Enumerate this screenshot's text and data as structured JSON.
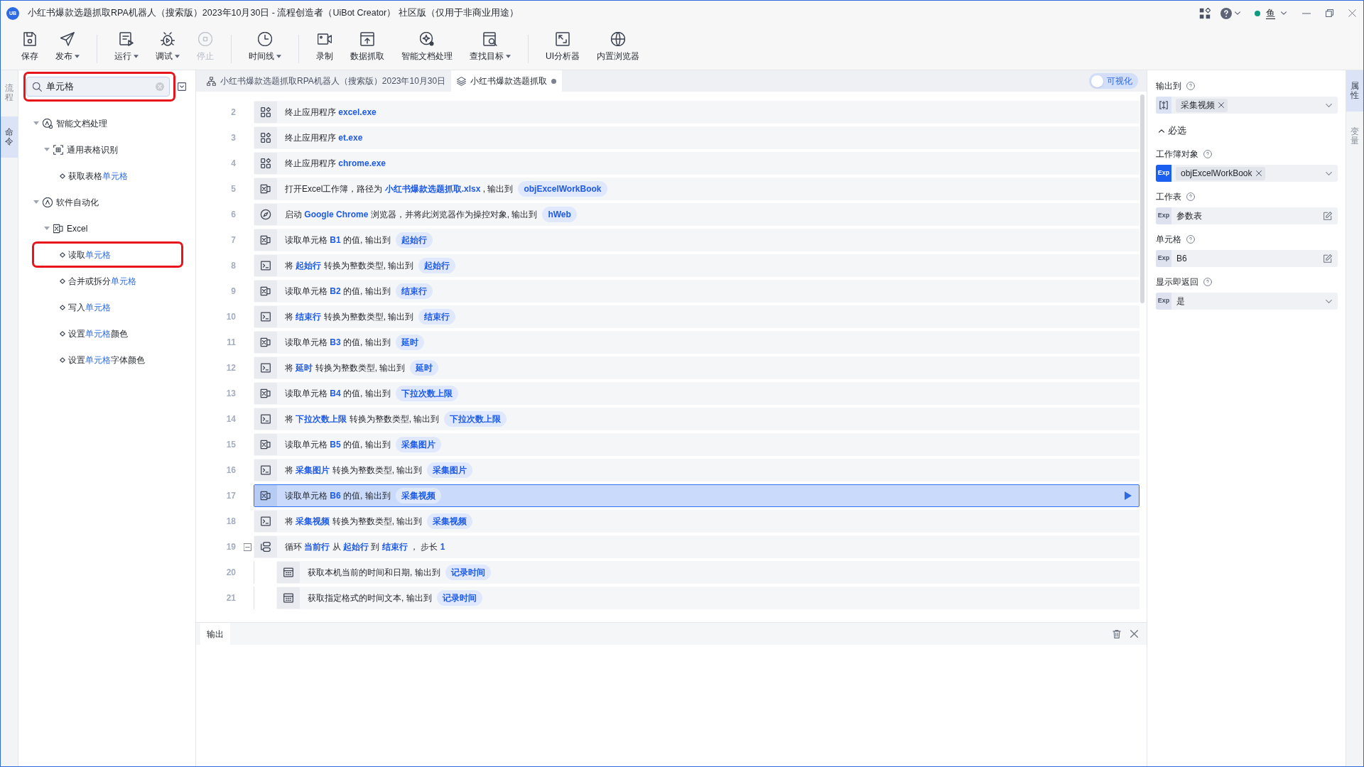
{
  "window": {
    "logo": "UB",
    "title": "小红书爆款选题抓取RPA机器人（搜索版）2023年10月30日 - 流程创造者（UiBot Creator） 社区版（仅用于非商业用途）",
    "user": "鱼"
  },
  "toolbar": {
    "groups": [
      {
        "items": [
          {
            "kind": "save",
            "label": "保存",
            "dropdown": false,
            "disabled": false
          },
          {
            "kind": "publish",
            "label": "发布",
            "dropdown": true,
            "disabled": false
          }
        ]
      },
      {
        "items": [
          {
            "kind": "run",
            "label": "运行",
            "dropdown": true,
            "disabled": false
          },
          {
            "kind": "debug",
            "label": "调试",
            "dropdown": true,
            "disabled": false
          },
          {
            "kind": "stop",
            "label": "停止",
            "dropdown": false,
            "disabled": true
          }
        ]
      },
      {
        "items": [
          {
            "kind": "timeline",
            "label": "时间线",
            "dropdown": true,
            "disabled": false
          }
        ]
      },
      {
        "items": [
          {
            "kind": "record",
            "label": "录制",
            "dropdown": false,
            "disabled": false
          },
          {
            "kind": "scrape",
            "label": "数据抓取",
            "dropdown": false,
            "disabled": false
          },
          {
            "kind": "document",
            "label": "智能文档处理",
            "dropdown": false,
            "disabled": false
          },
          {
            "kind": "find",
            "label": "查找目标",
            "dropdown": true,
            "disabled": false
          }
        ]
      },
      {
        "items": [
          {
            "kind": "ui-analyzer",
            "label": "UI分析器",
            "dropdown": false,
            "disabled": false
          },
          {
            "kind": "browser",
            "label": "内置浏览器",
            "dropdown": false,
            "disabled": false
          }
        ]
      }
    ]
  },
  "left_tabs": [
    {
      "label": "流程",
      "selected": false
    },
    {
      "label": "命令",
      "selected": true
    }
  ],
  "command_panel": {
    "search": {
      "value": "单元格",
      "highlighted": true
    },
    "tree": [
      {
        "kind": "ai",
        "label_parts": [
          {
            "text": "智能文档处理",
            "match": false
          }
        ],
        "expanded": true,
        "highlighted": false,
        "children": [
          {
            "kind": "table",
            "label_parts": [
              {
                "text": "通用表格识别",
                "match": false
              }
            ],
            "expanded": true,
            "highlighted": false,
            "children": [
              {
                "kind": "command",
                "label_parts": [
                  {
                    "text": "获取表格",
                    "match": false
                  },
                  {
                    "text": "单元格",
                    "match": true
                  }
                ],
                "highlighted": false
              }
            ]
          }
        ]
      },
      {
        "kind": "automation",
        "label_parts": [
          {
            "text": "软件自动化",
            "match": false
          }
        ],
        "expanded": true,
        "highlighted": false,
        "children": [
          {
            "kind": "excel",
            "label_parts": [
              {
                "text": "Excel",
                "match": false
              }
            ],
            "expanded": true,
            "highlighted": false,
            "children": [
              {
                "kind": "command",
                "label_parts": [
                  {
                    "text": "读取",
                    "match": false
                  },
                  {
                    "text": "单元格",
                    "match": true
                  }
                ],
                "highlighted": true
              },
              {
                "kind": "command",
                "label_parts": [
                  {
                    "text": "合并或拆分",
                    "match": false
                  },
                  {
                    "text": "单元格",
                    "match": true
                  }
                ],
                "highlighted": false
              },
              {
                "kind": "command",
                "label_parts": [
                  {
                    "text": "写入",
                    "match": false
                  },
                  {
                    "text": "单元格",
                    "match": true
                  }
                ],
                "highlighted": false
              },
              {
                "kind": "command",
                "label_parts": [
                  {
                    "text": "设置",
                    "match": false
                  },
                  {
                    "text": "单元格",
                    "match": true
                  },
                  {
                    "text": "颜色",
                    "match": false
                  }
                ],
                "highlighted": false
              },
              {
                "kind": "command",
                "label_parts": [
                  {
                    "text": "设置",
                    "match": false
                  },
                  {
                    "text": "单元格",
                    "match": true
                  },
                  {
                    "text": "字体颜色",
                    "match": false
                  }
                ],
                "highlighted": false
              }
            ]
          }
        ]
      }
    ]
  },
  "editor": {
    "tabs": [
      {
        "kind": "flow",
        "label": "小红书爆款选题抓取RPA机器人（搜索版）2023年10月30日",
        "selected": false,
        "modified": false
      },
      {
        "kind": "block",
        "label": "小红书爆款选题抓取",
        "selected": true,
        "modified": true
      }
    ],
    "visual_toggle": {
      "label": "可视化",
      "on": true
    },
    "rows": [
      {
        "number": "2",
        "kind": "app",
        "command": "终止应用程序 **excel.exe**",
        "selected": false
      },
      {
        "number": "3",
        "kind": "app",
        "command": "终止应用程序 **et.exe**",
        "selected": false
      },
      {
        "number": "4",
        "kind": "app",
        "command": "终止应用程序 **chrome.exe**",
        "selected": false
      },
      {
        "number": "5",
        "kind": "excel",
        "command": "打开Excel工作簿，路径为 **小红书爆款选题抓取.xlsx** , 输出到",
        "output": "objExcelWorkBook",
        "selected": false
      },
      {
        "number": "6",
        "kind": "browser",
        "command": "启动 **Google Chrome** 浏览器，并将此浏览器作为操控对象, 输出到",
        "output": "hWeb",
        "selected": false
      },
      {
        "number": "7",
        "kind": "excel",
        "command": "读取单元格 **B1** 的值, 输出到",
        "output": "起始行",
        "selected": false
      },
      {
        "number": "8",
        "kind": "convert",
        "command": "将 **起始行** 转换为整数类型, 输出到",
        "output": "起始行",
        "selected": false
      },
      {
        "number": "9",
        "kind": "excel",
        "command": "读取单元格 **B2** 的值, 输出到",
        "output": "结束行",
        "selected": false
      },
      {
        "number": "10",
        "kind": "convert",
        "command": "将 **结束行** 转换为整数类型, 输出到",
        "output": "结束行",
        "selected": false
      },
      {
        "number": "11",
        "kind": "excel",
        "command": "读取单元格 **B3** 的值, 输出到",
        "output": "延时",
        "selected": false
      },
      {
        "number": "12",
        "kind": "convert",
        "command": "将 **延时** 转换为整数类型, 输出到",
        "output": "延时",
        "selected": false
      },
      {
        "number": "13",
        "kind": "excel",
        "command": "读取单元格 **B4** 的值, 输出到",
        "output": "下拉次数上限",
        "selected": false
      },
      {
        "number": "14",
        "kind": "convert",
        "command": "将 **下拉次数上限** 转换为整数类型, 输出到",
        "output": "下拉次数上限",
        "selected": false
      },
      {
        "number": "15",
        "kind": "excel",
        "command": "读取单元格 **B5** 的值, 输出到",
        "output": "采集图片",
        "selected": false
      },
      {
        "number": "16",
        "kind": "convert",
        "command": "将 **采集图片** 转换为整数类型, 输出到",
        "output": "采集图片",
        "selected": false
      },
      {
        "number": "17",
        "kind": "excel",
        "command": "读取单元格 **B6** 的值, 输出到",
        "output": "采集视频",
        "selected": true
      },
      {
        "number": "18",
        "kind": "convert",
        "command": "将 **采集视频** 转换为整数类型, 输出到",
        "output": "采集视频",
        "selected": false
      },
      {
        "number": "19",
        "kind": "loop",
        "command": "循环 **当前行** 从 **起始行** 到 **结束行** ， 步长 **1**",
        "selected": false,
        "expanded": true,
        "children": [
          {
            "number": "20",
            "kind": "datetime",
            "command": "获取本机当前的时间和日期, 输出到",
            "output": "记录时间",
            "selected": false
          },
          {
            "number": "21",
            "kind": "datetime",
            "command": "获取指定格式的时间文本, 输出到",
            "output": "记录时间",
            "selected": false
          }
        ]
      }
    ]
  },
  "output_panel": {
    "tabs": [
      {
        "label": "输出",
        "selected": true
      }
    ]
  },
  "properties": {
    "fields": [
      {
        "kind": "output",
        "label": "输出到",
        "tags": [
          "采集视频"
        ]
      }
    ],
    "section": {
      "label": "必选",
      "expanded": true,
      "fields": [
        {
          "kind": "tags",
          "label": "工作簿对象",
          "badge": "Exp",
          "exp": true,
          "tags": [
            "objExcelWorkBook"
          ]
        },
        {
          "kind": "text",
          "label": "工作表",
          "badge": "Exp",
          "exp": false,
          "value": "参数表"
        },
        {
          "kind": "text",
          "label": "单元格",
          "badge": "Exp",
          "exp": false,
          "value": "B6"
        },
        {
          "kind": "select",
          "label": "显示即返回",
          "badge": "Exp",
          "exp": false,
          "value": "是"
        }
      ]
    }
  },
  "right_tabs": [
    {
      "label": "属性",
      "selected": true
    },
    {
      "label": "变量",
      "selected": false
    }
  ]
}
